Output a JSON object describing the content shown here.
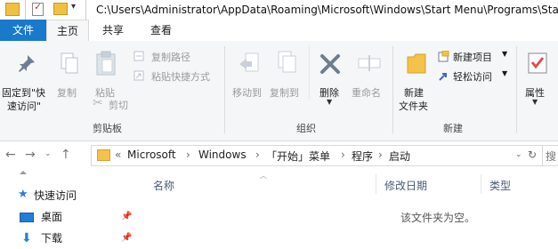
{
  "titlebar": {
    "path": "C:\\Users\\Administrator\\AppData\\Roaming\\Microsoft\\Windows\\Start Menu\\Programs\\Sta"
  },
  "tabs": {
    "file": "文件",
    "home": "主页",
    "share": "共享",
    "view": "查看"
  },
  "ribbon": {
    "pin_label_1": "固定到\"快",
    "pin_label_2": "速访问\"",
    "copy": "复制",
    "paste": "粘贴",
    "copy_path": "复制路径",
    "paste_shortcut": "粘贴快捷方式",
    "cut": "剪切",
    "clipboard_group": "剪贴板",
    "move_to": "移动到",
    "copy_to": "复制到",
    "delete": "删除",
    "rename": "重命名",
    "organize_group": "组织",
    "new_folder_1": "新建",
    "new_folder_2": "文件夹",
    "new_item": "新建项目",
    "easy_access": "轻松访问",
    "new_group": "新建",
    "properties": "属性"
  },
  "address": {
    "overflow": "«",
    "crumbs": [
      "Microsoft",
      "Windows",
      "「开始」菜单",
      "程序",
      "启动"
    ],
    "search_placeholder": "搜"
  },
  "navpane": {
    "items": [
      {
        "label": "快速访问"
      },
      {
        "label": "桌面"
      },
      {
        "label": "下载"
      }
    ]
  },
  "content": {
    "columns": {
      "name": "名称",
      "date": "修改日期",
      "type": "类型"
    },
    "empty_message": "该文件夹为空。"
  }
}
